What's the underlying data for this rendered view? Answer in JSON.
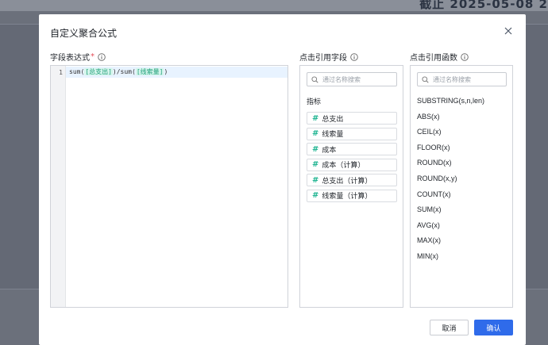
{
  "backdrop": {
    "header_text": "截止 2025-05-08 2"
  },
  "dialog": {
    "title": "自定义聚合公式",
    "expression": {
      "label": "字段表达式",
      "required_mark": "*",
      "line_number": "1",
      "code": {
        "prefix": "sum(",
        "token1": "[总支出]",
        "middle": ")/sum(",
        "token2": "[线索量]",
        "suffix": ")"
      }
    },
    "fields_panel": {
      "label": "点击引用字段",
      "search_placeholder": "通过名称搜索",
      "group_label": "指标",
      "items": [
        {
          "symbol": "#",
          "name": "总支出"
        },
        {
          "symbol": "#",
          "name": "线索量"
        },
        {
          "symbol": "#",
          "name": "成本"
        },
        {
          "symbol": "#",
          "name": "成本（计算）"
        },
        {
          "symbol": "#",
          "name": "总支出（计算）"
        },
        {
          "symbol": "#",
          "name": "线索量（计算）"
        }
      ]
    },
    "functions_panel": {
      "label": "点击引用函数",
      "search_placeholder": "通过名称搜索",
      "items": [
        "SUBSTRING(s,n,len)",
        "ABS(x)",
        "CEIL(x)",
        "FLOOR(x)",
        "ROUND(x)",
        "ROUND(x,y)",
        "COUNT(x)",
        "SUM(x)",
        "AVG(x)",
        "MAX(x)",
        "MIN(x)"
      ]
    },
    "buttons": {
      "cancel": "取消",
      "confirm": "确认"
    }
  },
  "colors": {
    "primary": "#2f6bea",
    "token_text": "#21a07c",
    "token_bg": "#d5f5ec",
    "required": "#e34d59",
    "overlay": "#646975"
  }
}
